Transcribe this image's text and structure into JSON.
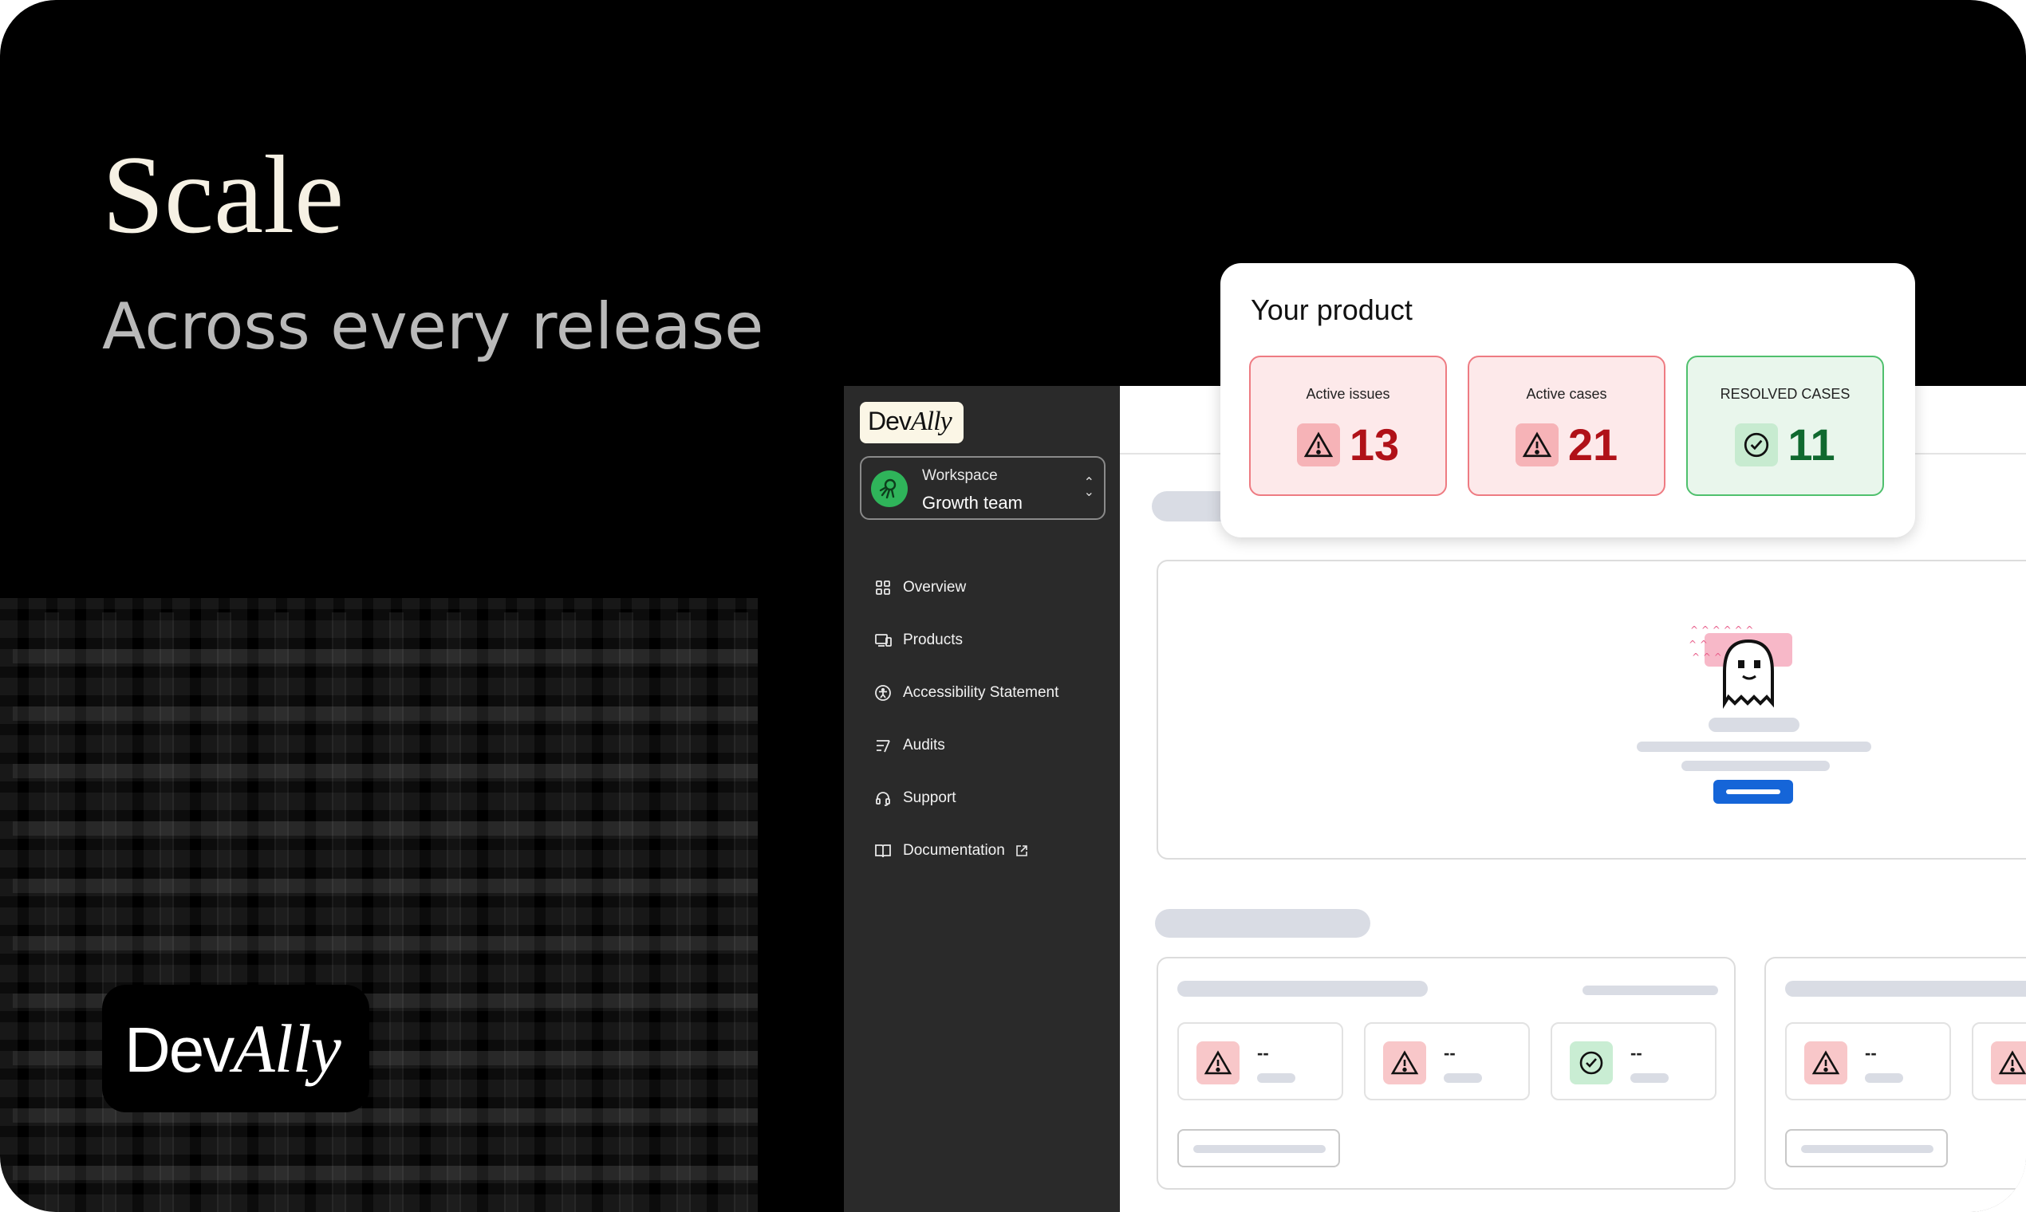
{
  "hero": {
    "title": "Scale",
    "subtitle": "Across every release",
    "logo_dev": "Dev",
    "logo_ally": "Ally"
  },
  "sidebar": {
    "logo_dev": "Dev",
    "logo_ally": "Ally",
    "workspace": {
      "label": "Workspace",
      "name": "Growth team"
    },
    "items": [
      {
        "label": "Overview",
        "icon": "grid-icon"
      },
      {
        "label": "Products",
        "icon": "devices-icon"
      },
      {
        "label": "Accessibility Statement",
        "icon": "accessibility-icon"
      },
      {
        "label": "Audits",
        "icon": "audit-icon"
      },
      {
        "label": "Support",
        "icon": "headset-icon"
      },
      {
        "label": "Documentation",
        "icon": "book-icon",
        "external": true
      }
    ]
  },
  "product_card": {
    "title": "Your product",
    "stats": [
      {
        "label": "Active issues",
        "value": "13",
        "status": "warning"
      },
      {
        "label": "Active cases",
        "value": "21",
        "status": "warning"
      },
      {
        "label": "RESOLVED CASES",
        "value": "11",
        "status": "resolved"
      }
    ]
  },
  "placeholders": {
    "dash": "--"
  },
  "colors": {
    "accent_blue": "#1565d8",
    "warning_red": "#b01118",
    "success_green": "#10692f",
    "workspace_green": "#2fb45a"
  }
}
